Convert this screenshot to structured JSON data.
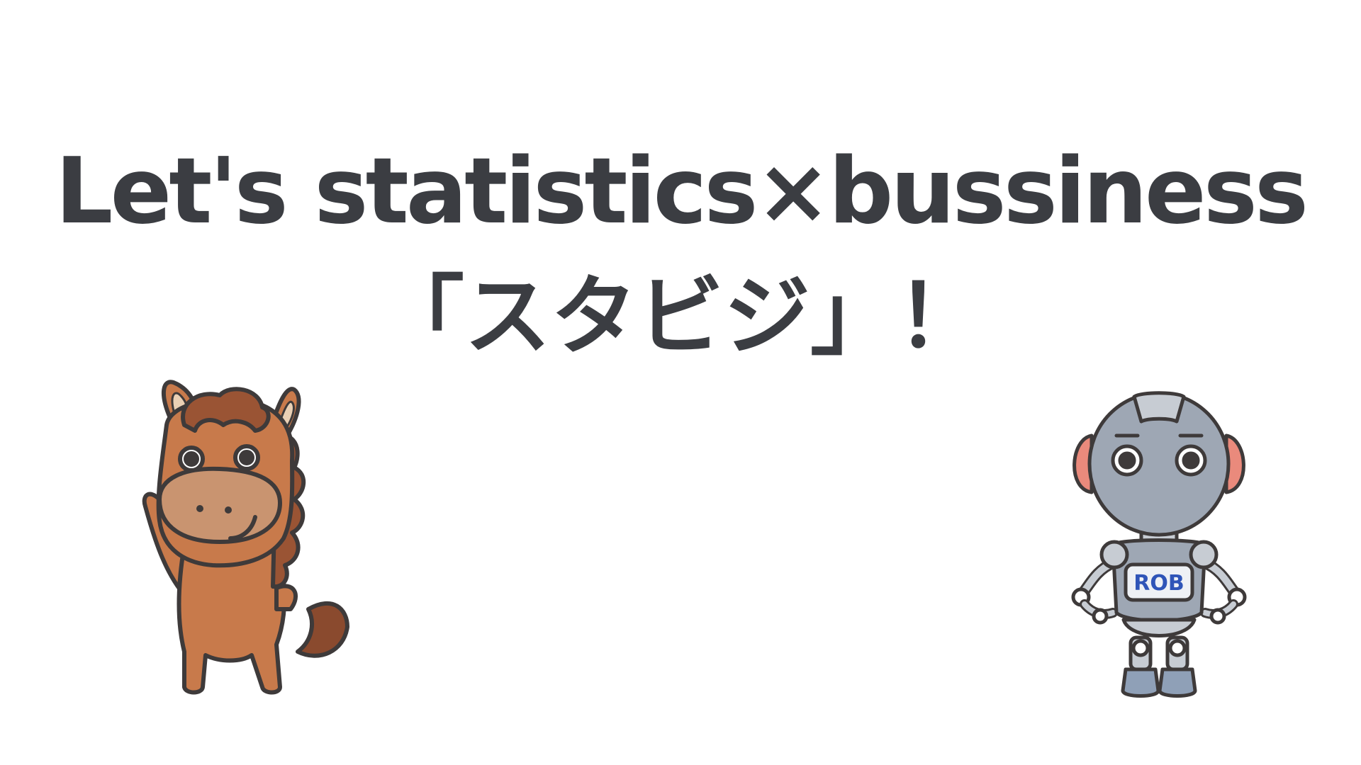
{
  "slide": {
    "title_line1": "Let's statistics×bussiness",
    "title_line2": "「スタビジ」！"
  },
  "characters": {
    "horse": {
      "icon": "waving-horse-character"
    },
    "robot": {
      "icon": "robot-character",
      "badge_label": "ROB"
    }
  },
  "colors": {
    "text": "#3b3d42",
    "horse_body": "#c87a4b",
    "horse_mane": "#9a5434",
    "horse_muzzle": "#c99470",
    "robot_body": "#9ea7b4",
    "robot_ear": "#ea8a7c",
    "badge_text": "#2f55b8"
  }
}
